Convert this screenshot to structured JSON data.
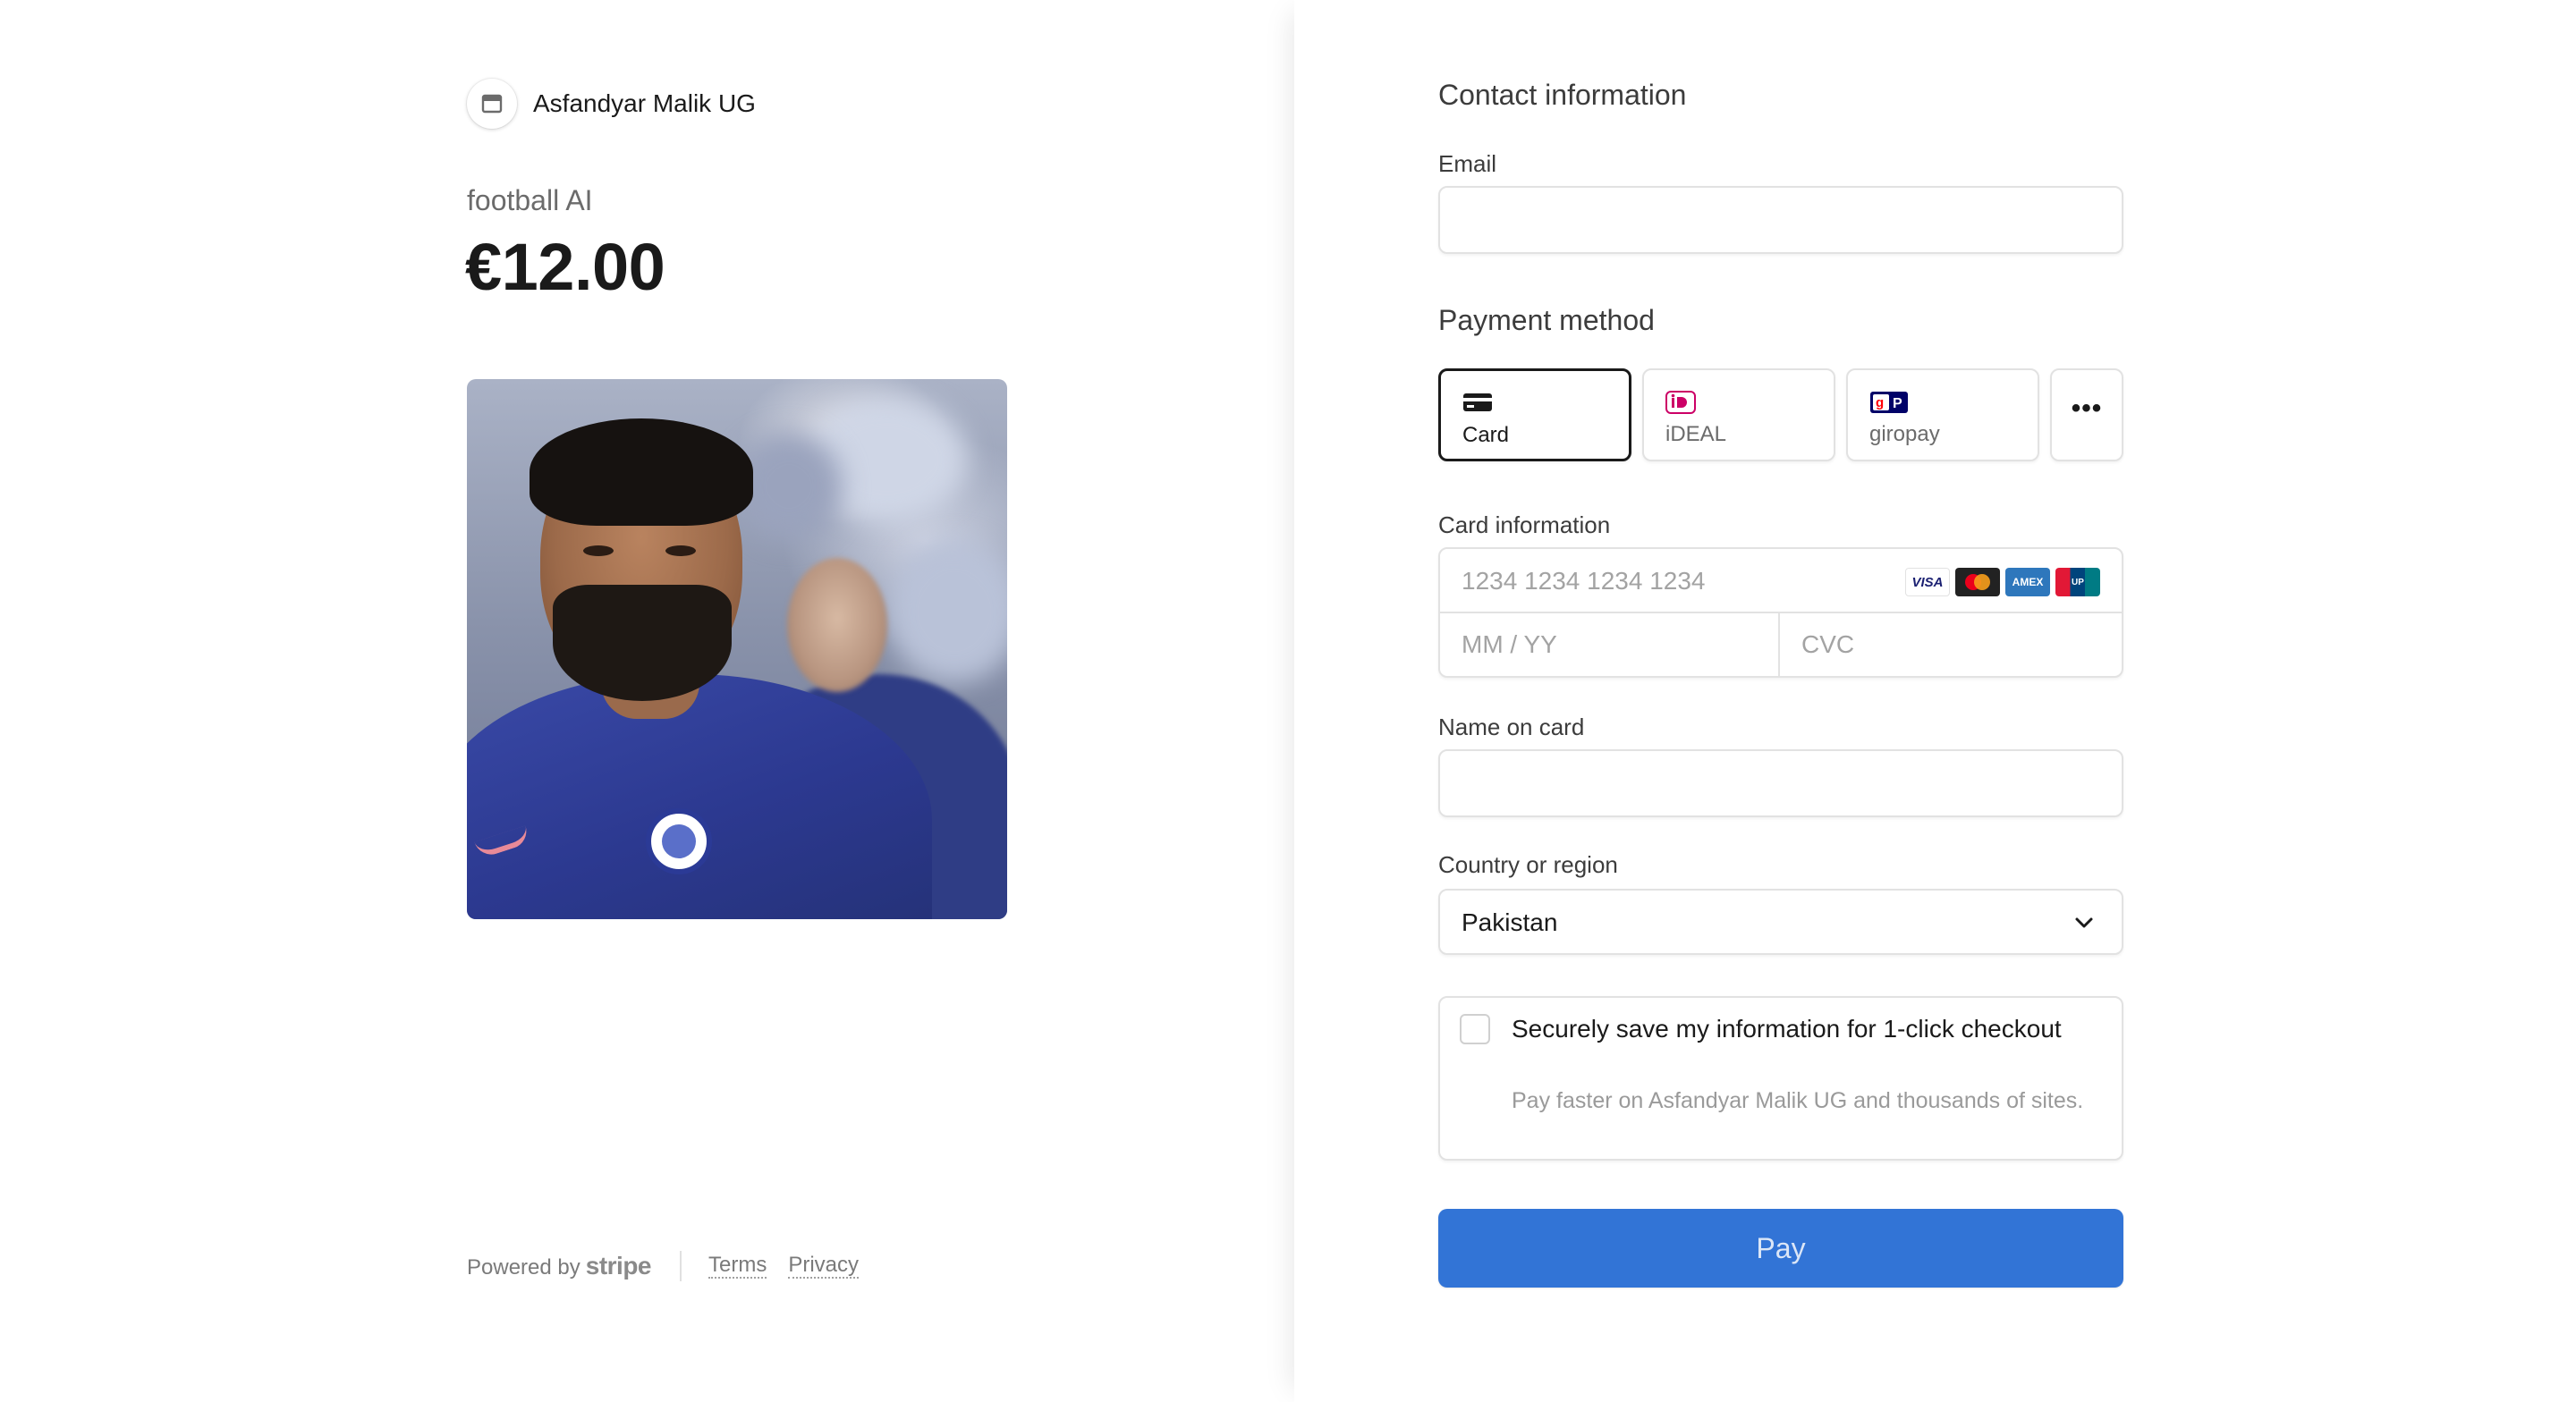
{
  "merchant": {
    "name": "Asfandyar Malik UG",
    "logo_icon": "store-icon"
  },
  "product": {
    "name": "football AI",
    "price": "€12.00"
  },
  "footer": {
    "powered_by": "Powered by",
    "brand": "stripe",
    "terms": "Terms",
    "privacy": "Privacy"
  },
  "contact": {
    "heading": "Contact information",
    "email_label": "Email",
    "email_value": "",
    "email_placeholder": ""
  },
  "payment": {
    "heading": "Payment method",
    "methods": [
      {
        "label": "Card",
        "icon": "card-icon",
        "selected": true
      },
      {
        "label": "iDEAL",
        "icon": "ideal-icon",
        "selected": false
      },
      {
        "label": "giropay",
        "icon": "giropay-icon",
        "selected": false
      }
    ],
    "more_icon": "more-dots-icon"
  },
  "card": {
    "label": "Card information",
    "number_placeholder": "1234 1234 1234 1234",
    "expiry_placeholder": "MM / YY",
    "cvc_placeholder": "CVC",
    "brands": [
      "visa",
      "mastercard",
      "amex",
      "unionpay"
    ]
  },
  "name_on_card": {
    "label": "Name on card",
    "value": ""
  },
  "country": {
    "label": "Country or region",
    "value": "Pakistan"
  },
  "save_info": {
    "title": "Securely save my information for 1-click checkout",
    "subtitle": "Pay faster on Asfandyar Malik UG and thousands of sites.",
    "checked": false
  },
  "pay_button": {
    "label": "Pay"
  },
  "colors": {
    "accent": "#3274d6",
    "border": "#e2e2e2",
    "muted_text": "#6b6b6b"
  }
}
